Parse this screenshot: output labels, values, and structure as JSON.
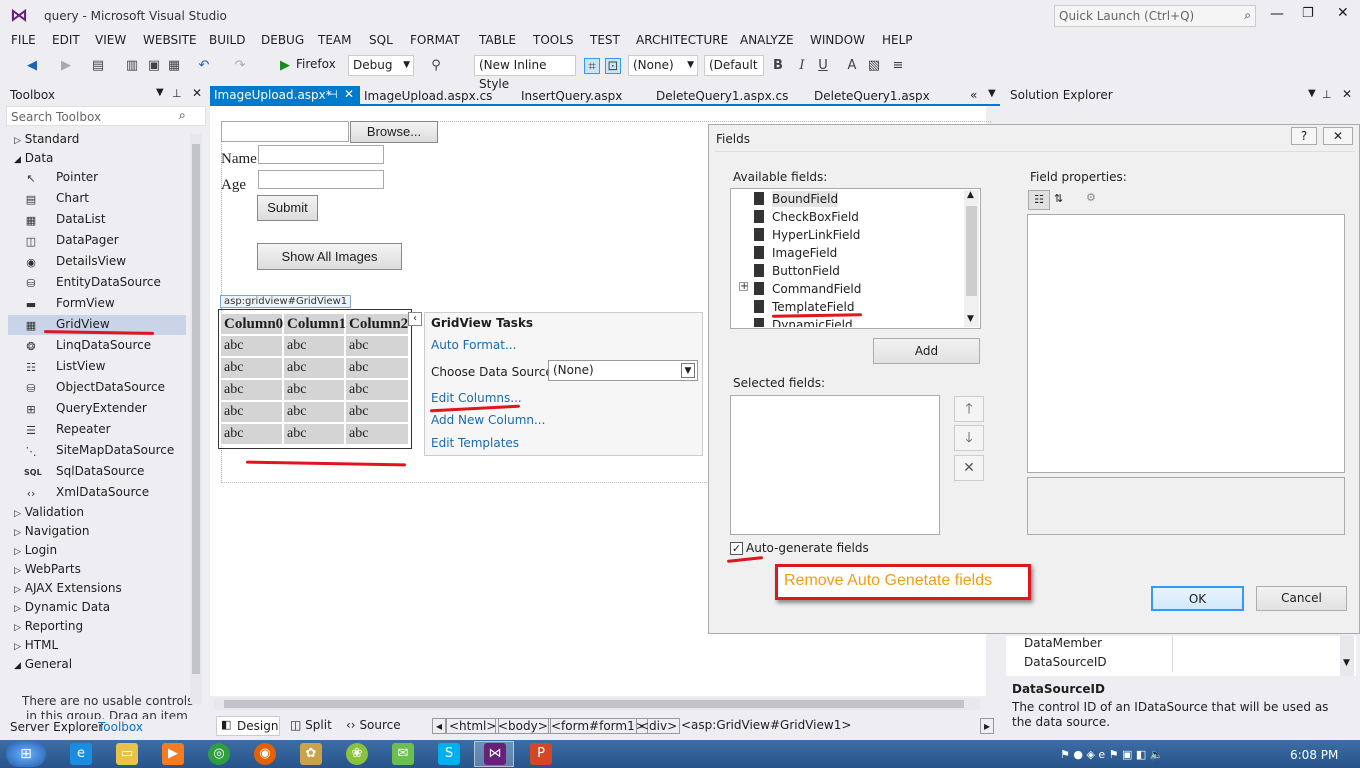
{
  "window": {
    "title": "query - Microsoft Visual Studio",
    "quick_launch_placeholder": "Quick Launch (Ctrl+Q)"
  },
  "menu": [
    "FILE",
    "EDIT",
    "VIEW",
    "WEBSITE",
    "BUILD",
    "DEBUG",
    "TEAM",
    "SQL",
    "FORMAT",
    "TABLE",
    "TOOLS",
    "TEST",
    "ARCHITECTURE",
    "ANALYZE",
    "WINDOW",
    "HELP"
  ],
  "toolbar": {
    "browser": "Firefox",
    "config": "Debug",
    "style": "(New Inline Style",
    "target": "(None)",
    "font": "(Default"
  },
  "toolbox": {
    "title": "Toolbox",
    "search_placeholder": "Search Toolbox",
    "groups_top": [
      "Standard",
      "Data"
    ],
    "data_items": [
      "Pointer",
      "Chart",
      "DataList",
      "DataPager",
      "DetailsView",
      "EntityDataSource",
      "FormView",
      "GridView",
      "LinqDataSource",
      "ListView",
      "ObjectDataSource",
      "QueryExtender",
      "Repeater",
      "SiteMapDataSource",
      "SqlDataSource",
      "XmlDataSource"
    ],
    "groups_bottom": [
      "Validation",
      "Navigation",
      "Login",
      "WebParts",
      "AJAX Extensions",
      "Dynamic Data",
      "Reporting",
      "HTML",
      "General"
    ],
    "empty_msg_1": "There are no usable controls",
    "empty_msg_2": "in this group. Drag an item"
  },
  "bottom_tabs": {
    "server_explorer": "Server Explorer",
    "toolbox": "Toolbox"
  },
  "doc_tabs": [
    "ImageUpload.aspx*",
    "ImageUpload.aspx.cs",
    "InsertQuery.aspx",
    "DeleteQuery1.aspx.cs",
    "DeleteQuery1.aspx"
  ],
  "designer": {
    "browse_label": "Browse...",
    "name_label": "Name",
    "age_label": "Age",
    "submit_label": "Submit",
    "show_all_label": "Show All Images",
    "gridview_tag": "asp:gridview#GridView1",
    "grid_headers": [
      "Column0",
      "Column1",
      "Column2"
    ],
    "grid_rows": [
      [
        "abc",
        "abc",
        "abc"
      ],
      [
        "abc",
        "abc",
        "abc"
      ],
      [
        "abc",
        "abc",
        "abc"
      ],
      [
        "abc",
        "abc",
        "abc"
      ],
      [
        "abc",
        "abc",
        "abc"
      ]
    ],
    "tasks_title": "GridView Tasks",
    "auto_format": "Auto Format...",
    "choose_ds": "Choose Data Source:",
    "ds_value": "(None)",
    "edit_columns": "Edit Columns...",
    "add_column": "Add New Column...",
    "edit_templates": "Edit Templates"
  },
  "view_tabs": {
    "design": "Design",
    "split": "Split",
    "source": "Source"
  },
  "breadcrumb": [
    "<html>",
    "<body>",
    "<form#form1>",
    "<div>",
    "<asp:GridView#GridView1>"
  ],
  "solution_explorer": {
    "title": "Solution Explorer",
    "props": [
      {
        "name": "DataMember",
        "value": ""
      },
      {
        "name": "DataSourceID",
        "value": ""
      }
    ],
    "desc_title": "DataSourceID",
    "desc_text": "The control ID of an IDataSource that will be used as the data source."
  },
  "dialog": {
    "title": "Fields",
    "available_label": "Available fields:",
    "fields": [
      "BoundField",
      "CheckBoxField",
      "HyperLinkField",
      "ImageField",
      "ButtonField",
      "CommandField",
      "TemplateField",
      "DynamicField"
    ],
    "add_label": "Add",
    "selected_label": "Selected fields:",
    "props_label": "Field properties:",
    "auto_gen_label": "Auto-generate fields",
    "annotation": "Remove Auto Genetate fields",
    "ok_label": "OK",
    "cancel_label": "Cancel"
  },
  "taskbar": {
    "time": "6:08 PM"
  },
  "colors": {
    "accent": "#007acc",
    "annotation": "#e0151d",
    "link": "#1a6aaf"
  }
}
